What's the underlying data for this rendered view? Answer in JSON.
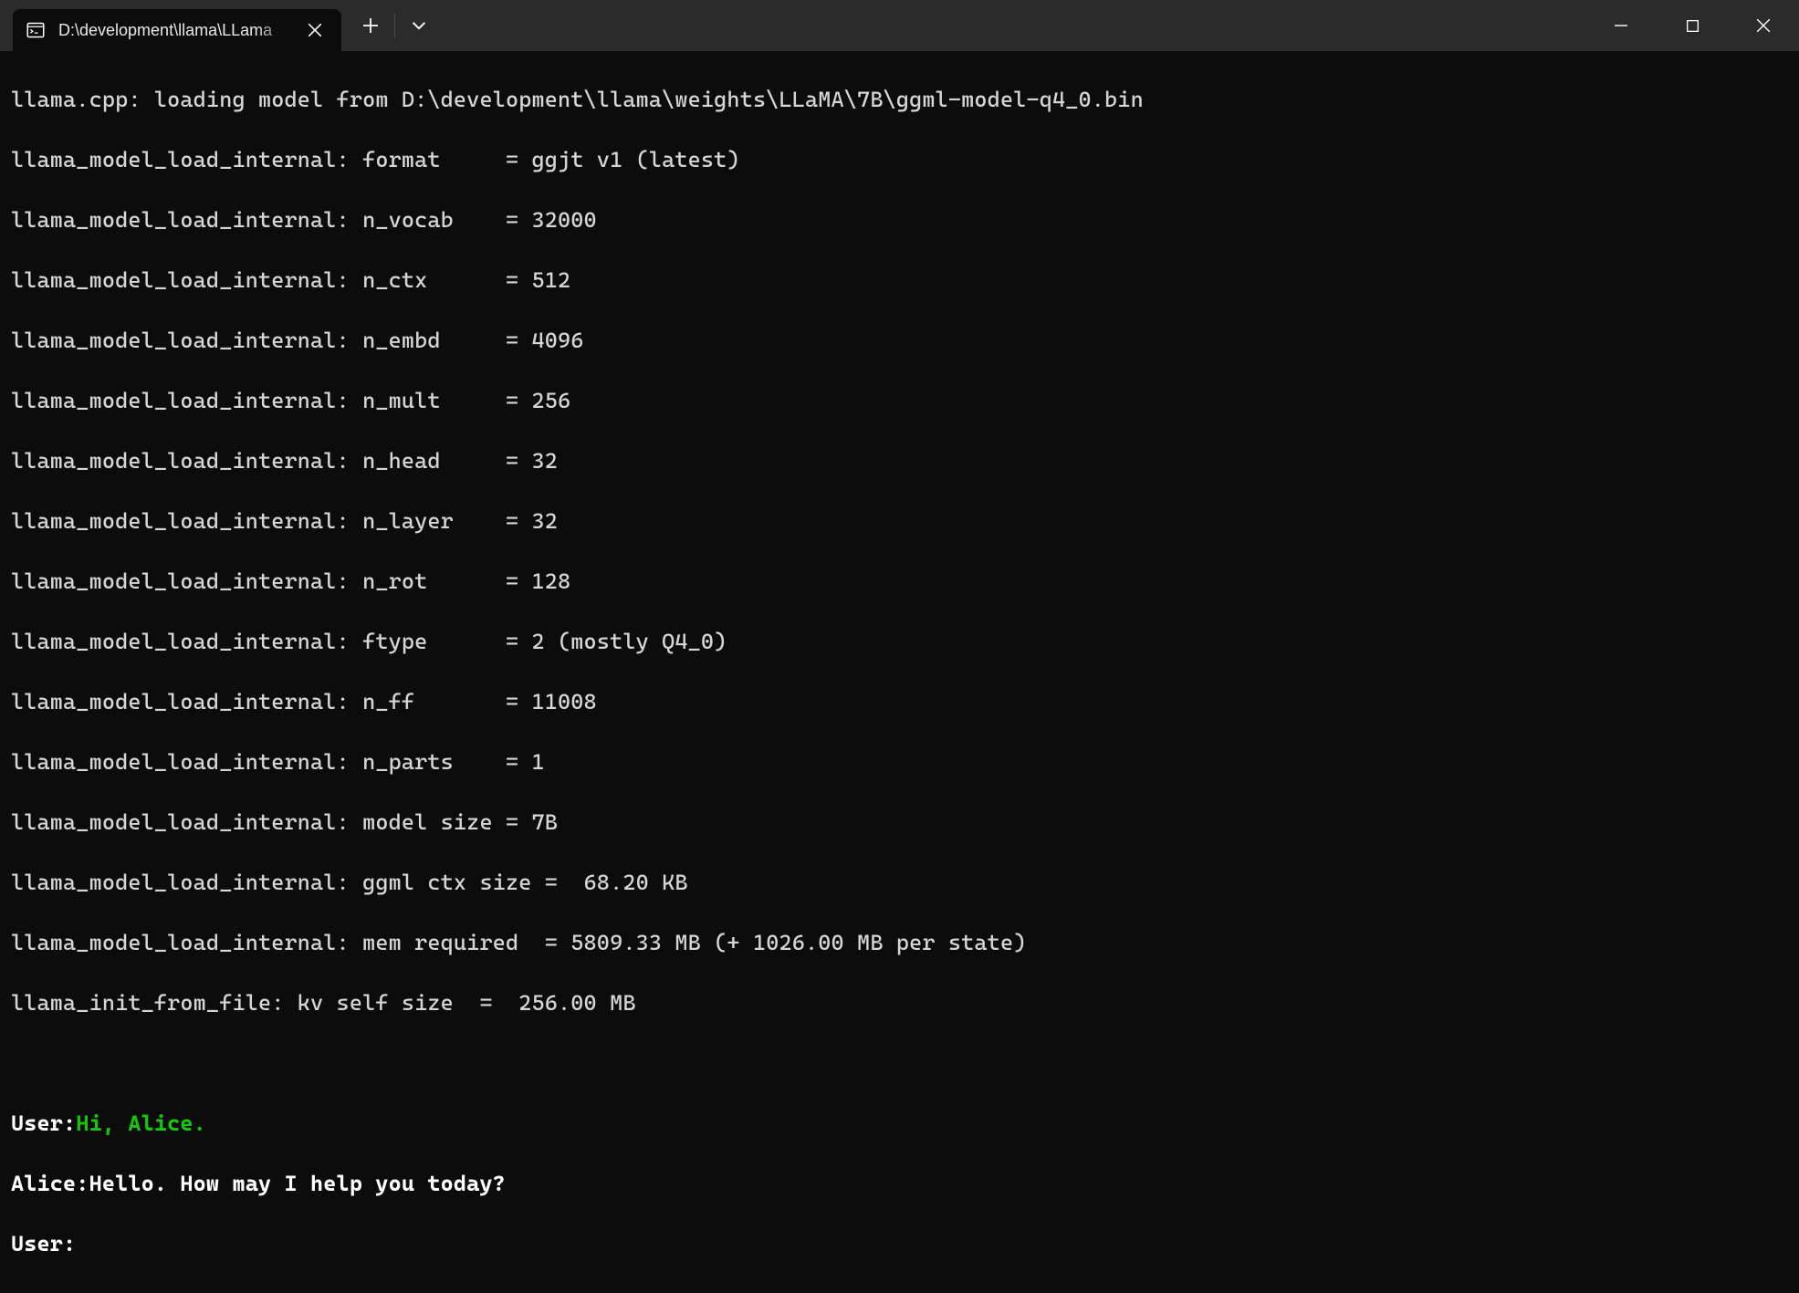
{
  "titlebar": {
    "tab_title": "D:\\development\\llama\\LLama",
    "icons": {
      "tab": "terminal-icon",
      "close": "close-icon",
      "new_tab": "plus-icon",
      "dropdown": "chevron-down-icon",
      "minimize": "minimize-icon",
      "maximize": "maximize-icon",
      "window_close": "close-icon"
    }
  },
  "terminal": {
    "lines": [
      "llama.cpp: loading model from D:\\development\\llama\\weights\\LLaMA\\7B\\ggml-model-q4_0.bin",
      "llama_model_load_internal: format     = ggjt v1 (latest)",
      "llama_model_load_internal: n_vocab    = 32000",
      "llama_model_load_internal: n_ctx      = 512",
      "llama_model_load_internal: n_embd     = 4096",
      "llama_model_load_internal: n_mult     = 256",
      "llama_model_load_internal: n_head     = 32",
      "llama_model_load_internal: n_layer    = 32",
      "llama_model_load_internal: n_rot      = 128",
      "llama_model_load_internal: ftype      = 2 (mostly Q4_0)",
      "llama_model_load_internal: n_ff       = 11008",
      "llama_model_load_internal: n_parts    = 1",
      "llama_model_load_internal: model size = 7B",
      "llama_model_load_internal: ggml ctx size =  68.20 KB",
      "llama_model_load_internal: mem required  = 5809.33 MB (+ 1026.00 MB per state)",
      "llama_init_from_file: kv self size  =  256.00 MB"
    ],
    "conversation": {
      "user1_label": "User:",
      "user1_text": "Hi, Alice.",
      "alice_line": "Alice:Hello. How may I help you today?",
      "user2_label": "User:"
    }
  }
}
